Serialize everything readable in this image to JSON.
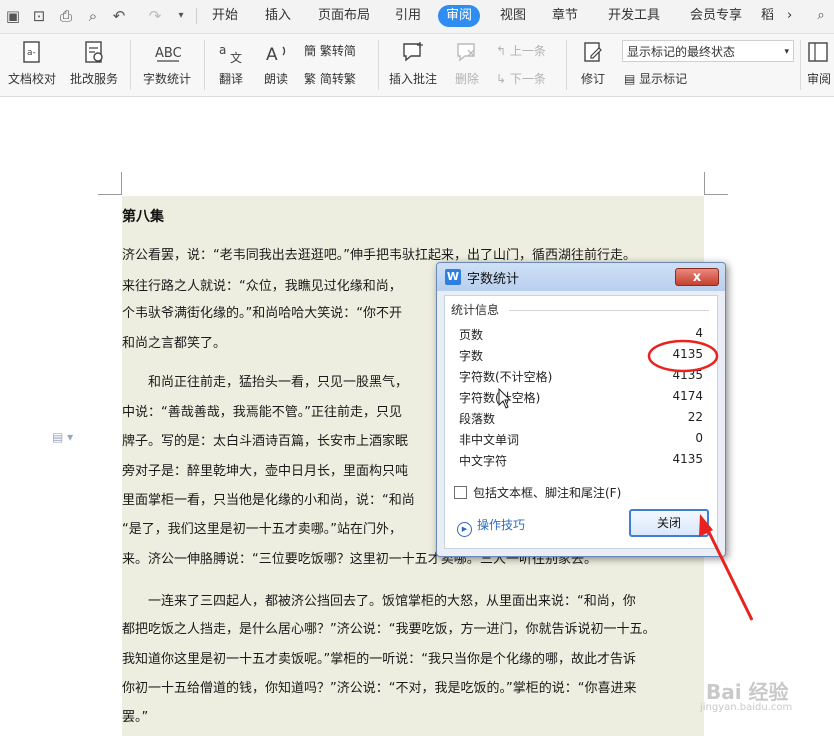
{
  "tabbar": {
    "tabs": [
      "开始",
      "插入",
      "页面布局",
      "引用",
      "审阅",
      "视图",
      "章节",
      "开发工具",
      "会员专享",
      "稻"
    ],
    "active_index": 4,
    "more": "›"
  },
  "ribbon": {
    "doc_proof": "文档校对",
    "batch_revise": "批改服务",
    "word_count": "字数统计",
    "translate": "翻译",
    "read_aloud": "朗读",
    "trad_to_simp": "繁转简",
    "simp_to_trad": "简转繁",
    "insert_comment": "插入批注",
    "delete": "删除",
    "prev": "上一条",
    "next": "下一条",
    "track": "修订",
    "markup_select": "显示标记的最终状态",
    "show_markup": "显示标记",
    "review": "审阅"
  },
  "document": {
    "chapter": "第八集",
    "lines": [
      "济公看罢，说：“老韦同我出去逛逛吧。”伸手把韦驮扛起来，出了山门，循西湖往前行走。",
      "来往行路之人就说：“众位，我瞧见过化缘和尚，",
      "个韦驮爷满街化缘的。”和尚哈哈大笑说：“你不开",
      "和尚之言都笑了。",
      "　　和尚正往前走，猛抬头一看，只见一股黑气，",
      "中说：“善哉善哉，我焉能不管。”正往前走，只见",
      "牌子。写的是：太白斗酒诗百篇，长安市上酒家眠",
      "旁对子是：醉里乾坤大，壶中日月长，里面构只吨",
      "里面掌柜一看，只当他是化缘的小和尚，说：“和尚",
      "“是了，我们这里是初一十五才卖哪。”站在门外，",
      "来。济公一伸胳膊说：“三位要吃饭哪？这里初一十五才卖哪。”三人一听往别家去。",
      "　　一连来了三四起人，都被济公挡回去了。饭馆掌柜的大怒，从里面出来说：“和尚，你",
      "都把吃饭之人挡走，是什么居心哪？”济公说：“我要吃饭，方一进门，你就告诉说初一十五。",
      "我知道你这里是初一十五才卖饭呢。”掌柜的一听说：“我只当你是个化缘的哪，故此才告诉",
      "你初一十五给僧道的钱，你知道吗？”济公说：“不对，我是吃饭的。”掌柜的说：“你喜进来",
      "罢。”"
    ]
  },
  "dialog": {
    "title": "字数统计",
    "app_icon": "W",
    "close_x": "x",
    "group_label": "统计信息",
    "stats": [
      {
        "label": "页数",
        "value": "4"
      },
      {
        "label": "字数",
        "value": "4135"
      },
      {
        "label": "字符数(不计空格)",
        "value": "4135"
      },
      {
        "label": "字符数(计空格)",
        "value": "4174"
      },
      {
        "label": "段落数",
        "value": "22"
      },
      {
        "label": "非中文单词",
        "value": "0"
      },
      {
        "label": "中文字符",
        "value": "4135"
      }
    ],
    "include_label": "包括文本框、脚注和尾注(F)",
    "tips_label": "操作技巧",
    "close_button": "关闭"
  },
  "watermark": {
    "brand": "Bai 经验",
    "url": "jingyan.baidu.com"
  },
  "colors": {
    "accent": "#2f8cf0",
    "annotation": "#e8231f"
  }
}
